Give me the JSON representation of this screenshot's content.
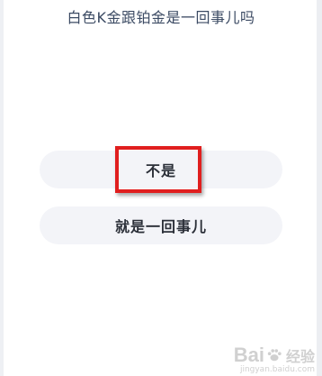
{
  "question": {
    "text": "白色K金跟铂金是一回事儿吗"
  },
  "options": [
    {
      "label": "不是",
      "highlighted": true
    },
    {
      "label": "就是一回事儿",
      "highlighted": false
    }
  ],
  "highlight_color": "#e01e1e",
  "watermark": {
    "logo_left": "Bai",
    "logo_right": "经验",
    "url": "jingyan.baidu.com"
  }
}
